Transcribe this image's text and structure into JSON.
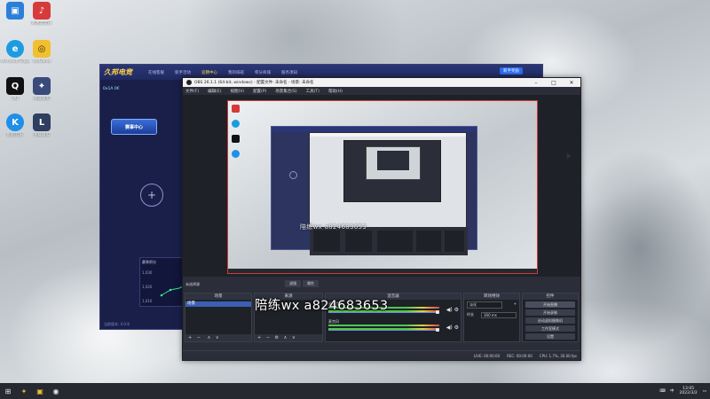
{
  "desktop": {
    "icons": [
      {
        "label": "",
        "color": "#2b7fd9",
        "glyph": "▣"
      },
      {
        "label": "网易云音乐",
        "color": "#d63a3a",
        "glyph": "♪"
      },
      {
        "label": "Microsoft Edge",
        "color": "#1e9be0",
        "glyph": "e"
      },
      {
        "label": "WeGame",
        "color": "#f0c030",
        "glyph": "◎"
      },
      {
        "label": "QQ",
        "color": "#111111",
        "glyph": "Q"
      },
      {
        "label": "英雄联盟",
        "color": "#3a4a7a",
        "glyph": "✦"
      },
      {
        "label": "酷狗音乐",
        "color": "#1f8fe8",
        "glyph": "K"
      },
      {
        "label": "英雄联盟",
        "color": "#2f3f5f",
        "glyph": "L"
      }
    ]
  },
  "game_window": {
    "logo": "久邦电竞",
    "tabs": [
      "在线客服",
      "新手活动",
      "竞猜中心",
      "我的排班",
      "积分商城",
      "服务须知"
    ],
    "active_tab_index": 2,
    "promo_label": "新手奖励",
    "counter": "0x1A 0€",
    "badge": "赛事中心",
    "status": "当前版本: 4.0.8",
    "mini_title": "赛季积分",
    "ticks": [
      "1,030",
      "1,020",
      "1,010"
    ]
  },
  "obs": {
    "title": "OBS 26.1.1 (64-bit, windows) - 配置文件: 未命名 - 场景: 未命名",
    "menu": [
      "文件(F)",
      "编辑(E)",
      "视图(V)",
      "配置(P)",
      "场景集合(S)",
      "工具(T)",
      "帮助(H)"
    ],
    "dock_tabs": [
      "滤镜",
      "属性"
    ],
    "scenes_title": "场景",
    "scene_item": "场景",
    "sources_title": "来源",
    "no_source_label": "未选择源",
    "mixer_title": "混音器",
    "mixer_rows": [
      "桌面音频",
      "麦克风"
    ],
    "transitions_title": "转场特效",
    "transition_value": "淡化",
    "duration_label": "时长",
    "duration_value": "300 ms",
    "controls_title": "控件",
    "controls": [
      "开始直播",
      "开始录制",
      "启动虚拟摄像机",
      "工作室模式",
      "设置",
      "退出"
    ],
    "status": {
      "live": "LIVE: 00:00:00",
      "rec": "REC: 00:00:00",
      "cpu": "CPU: 1.7%, 30.00 fps"
    },
    "inner_watermark": "陪练wx a824683653"
  },
  "overlay_watermark": "陪练wx a824683653",
  "taskbar": {
    "time": "13:05",
    "date": "2022/3/2",
    "lang": "中",
    "notification_count": "3"
  }
}
